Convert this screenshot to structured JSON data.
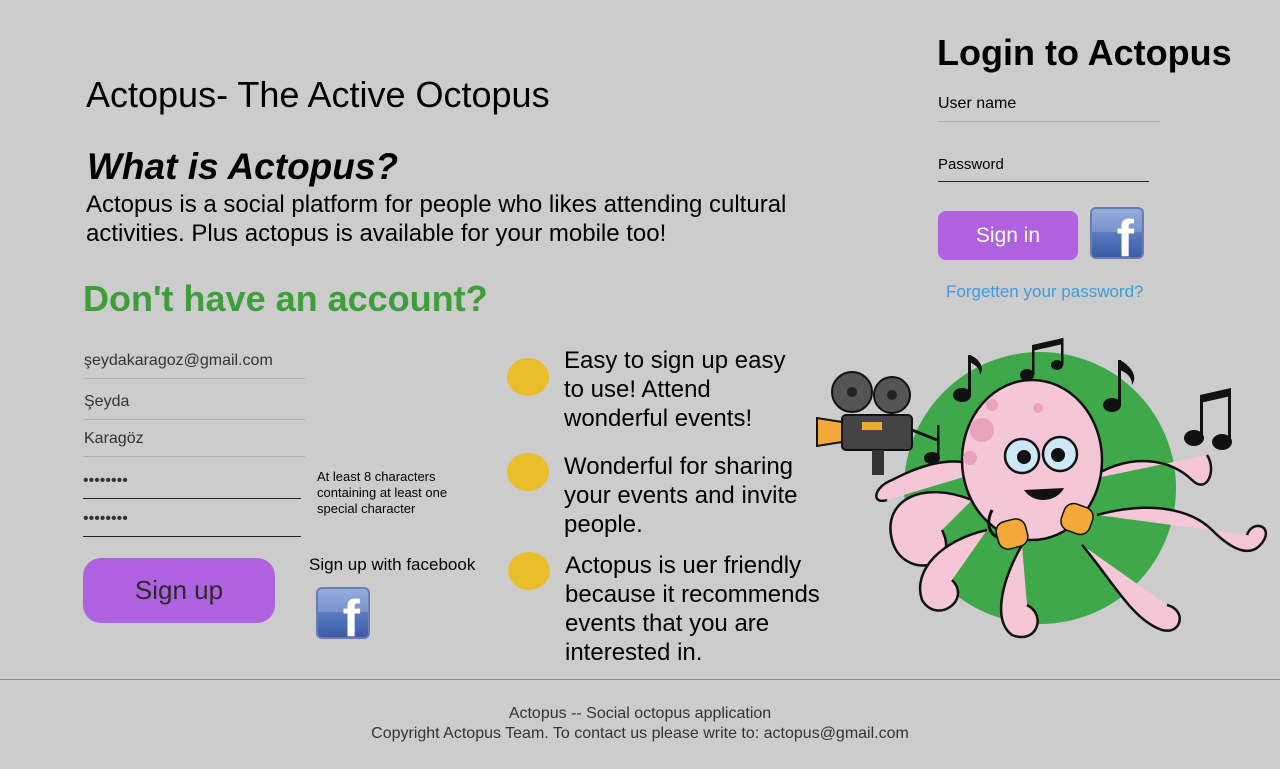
{
  "site": {
    "title": "Actopus- The Active Octopus",
    "what_heading": "What is Actopus?",
    "what_text": "Actopus is a social platform for people who likes attending cultural activities. Plus actopus is available for your mobile too!"
  },
  "signup": {
    "heading": "Don't have an account?",
    "email_value": "şeydakaragoz@gmail.com",
    "first_name_value": "Şeyda",
    "last_name_value": "Karagöz",
    "password_value": "••••••••",
    "password_confirm_value": "••••••••",
    "password_hint": "At least 8 characters containing at least one special character",
    "button_label": "Sign up",
    "facebook_label": "Sign up with facebook"
  },
  "features": [
    "Easy to sign up easy to use! Attend wonderful events!",
    "Wonderful for sharing your events and invite people.",
    "Actopus is uer friendly because it recommends events that you are interested in."
  ],
  "login": {
    "title": "Login to Actopus",
    "username_placeholder": "User name",
    "password_placeholder": "Password",
    "signin_label": "Sign in",
    "forgot_label": "Forgetten your password?"
  },
  "facebook_icon_letter": "f",
  "footer": {
    "line1": "Actopus -- Social octopus application",
    "line2": "Copyright Actopus Team. To contact us please write to: actopus@gmail.com"
  },
  "colors": {
    "background": "#cccccc",
    "accent_purple": "#b061e0",
    "heading_green": "#3f9e3c",
    "bullet_yellow": "#eabd2a",
    "link_blue": "#3d9be0",
    "facebook_blue": "#3b5ba6"
  }
}
